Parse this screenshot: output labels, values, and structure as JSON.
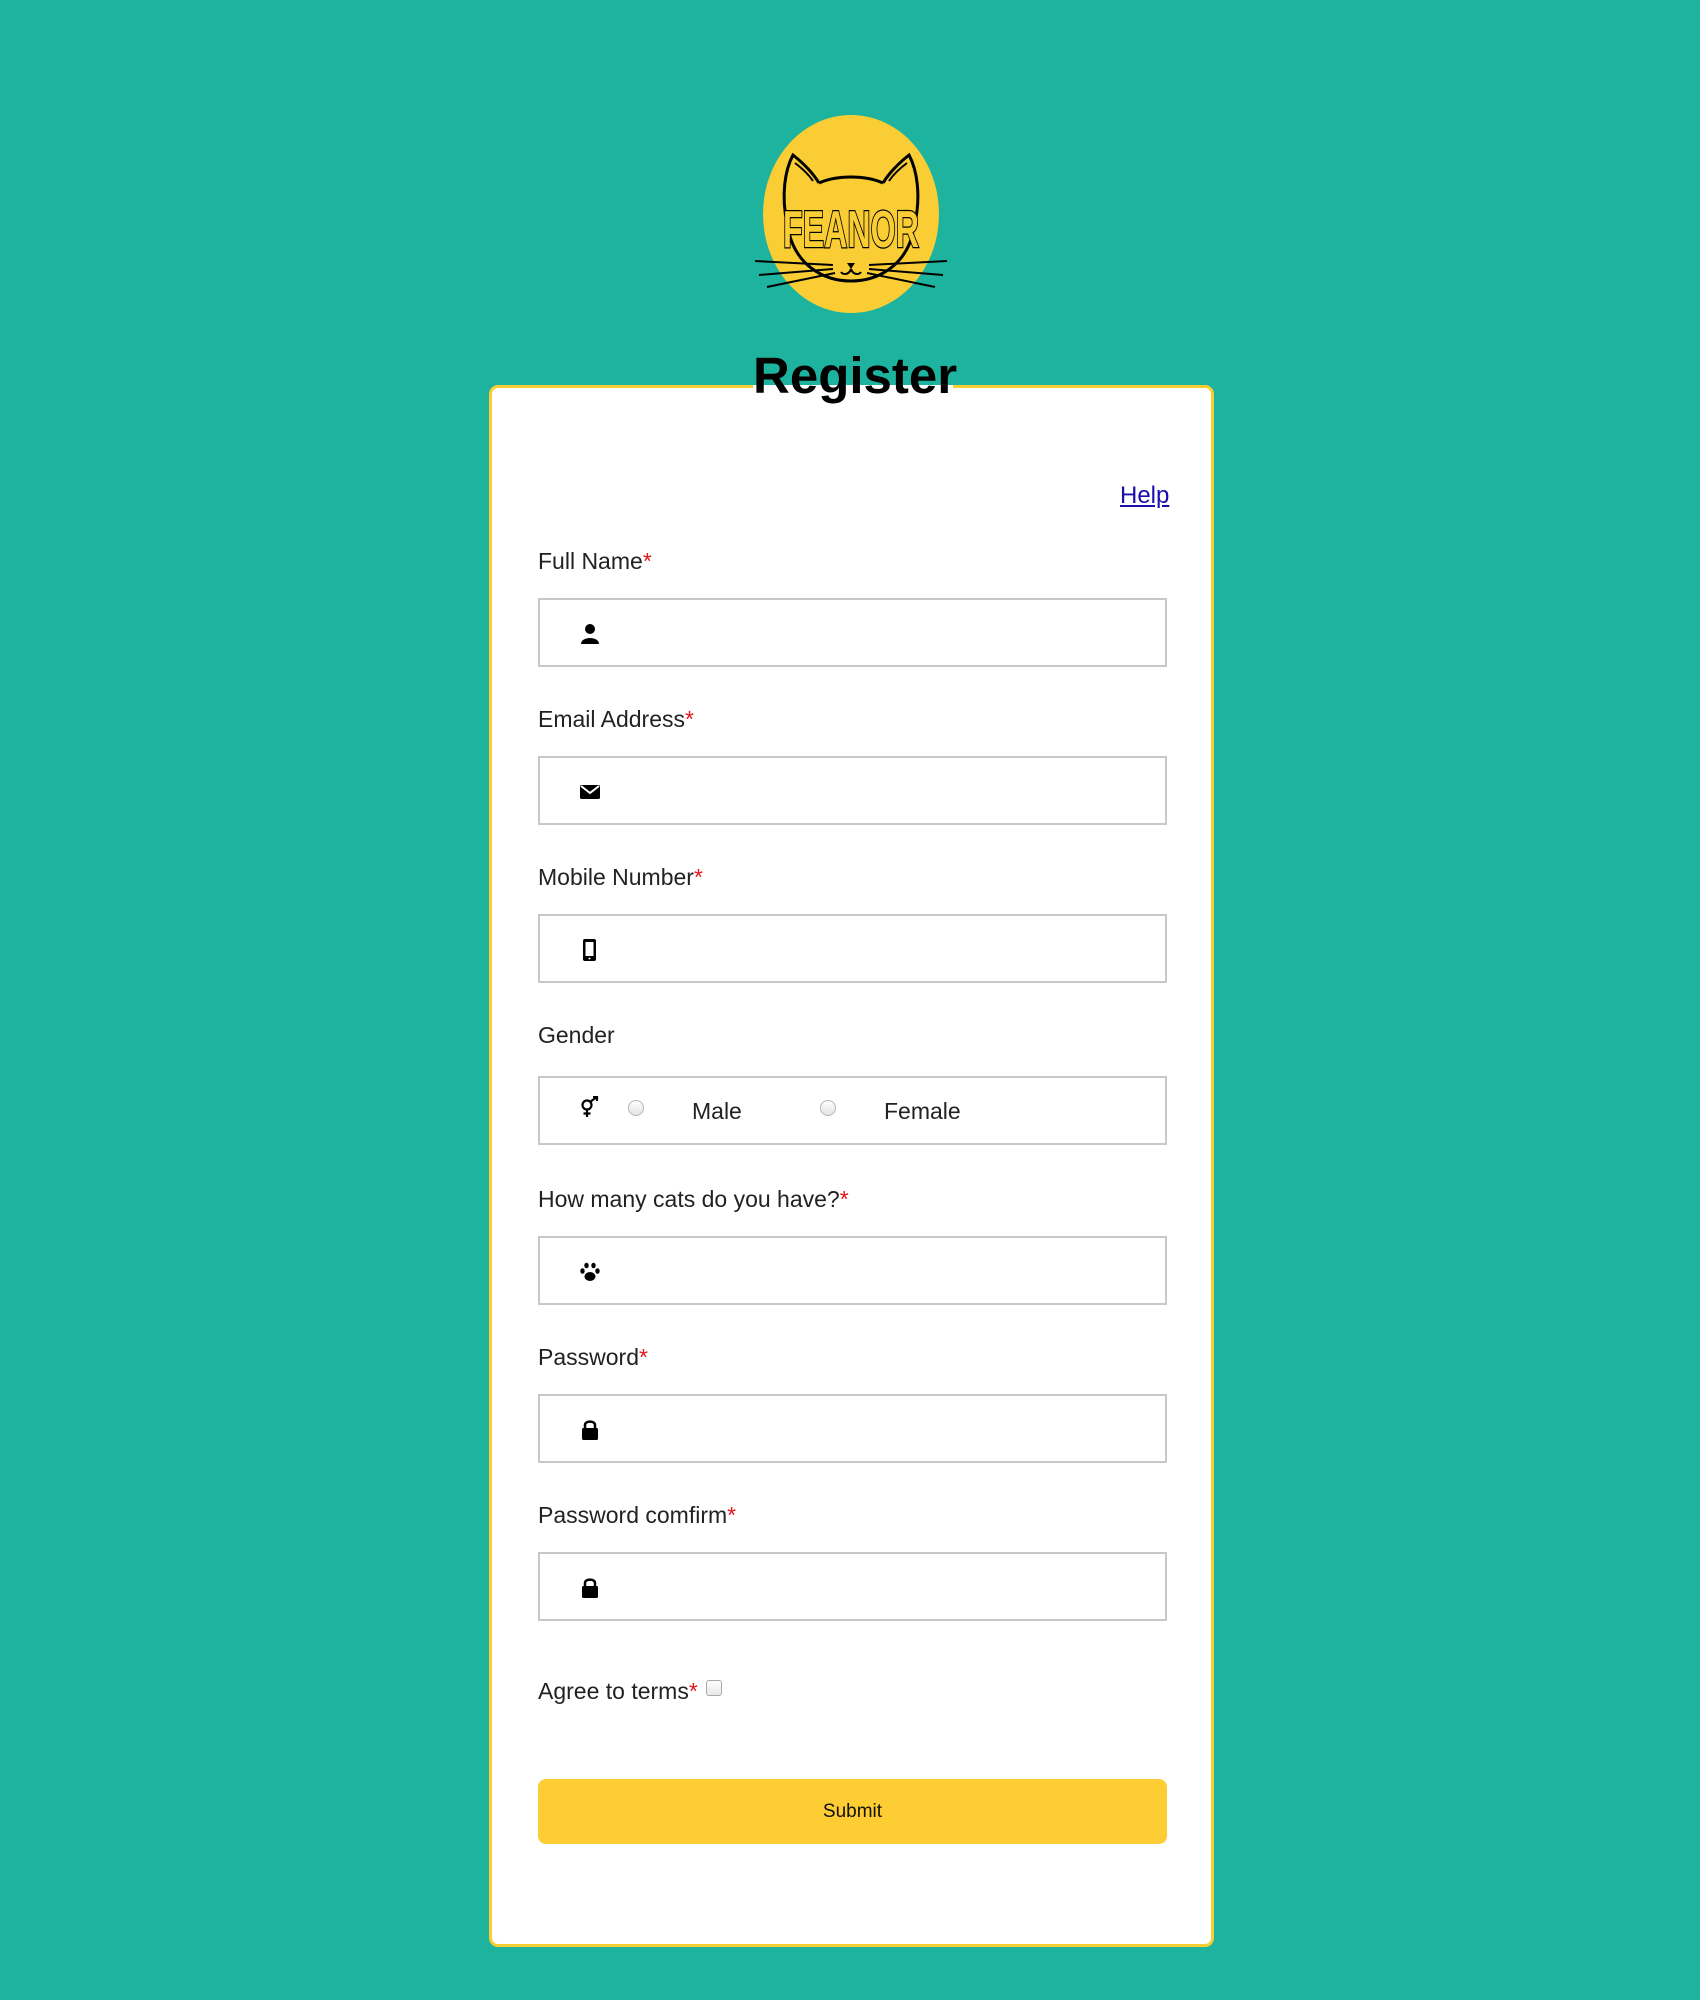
{
  "logo": {
    "text": "FEANOR",
    "icon": "cat-face-logo",
    "background_color": "#f9cd33"
  },
  "page": {
    "title": "Register",
    "background_color": "#1db39e"
  },
  "help": {
    "label": "Help"
  },
  "required_marker": "*",
  "fields": {
    "full_name": {
      "label": "Full Name",
      "icon": "user-icon",
      "value": ""
    },
    "email": {
      "label": "Email Address",
      "icon": "envelope-icon",
      "value": ""
    },
    "mobile": {
      "label": "Mobile Number",
      "icon": "mobile-phone-icon",
      "value": ""
    },
    "gender": {
      "label": "Gender",
      "icon": "gender-icon",
      "options": [
        "Male",
        "Female"
      ],
      "selected": ""
    },
    "cats": {
      "label": "How many cats do you have?",
      "icon": "paw-icon",
      "value": ""
    },
    "password": {
      "label": "Password",
      "icon": "lock-icon",
      "value": ""
    },
    "password_confirm": {
      "label": "Password comfirm",
      "icon": "lock-icon",
      "value": ""
    }
  },
  "terms": {
    "label": "Agree to terms",
    "checked": false
  },
  "submit": {
    "label": "Submit",
    "color": "#fdcd33"
  }
}
